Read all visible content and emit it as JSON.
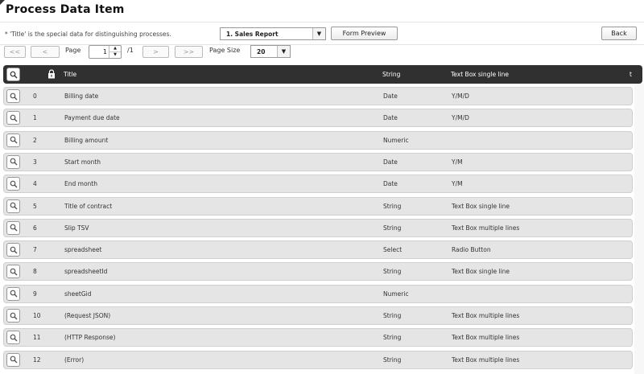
{
  "page": {
    "title": "Process Data Item"
  },
  "toolbar": {
    "note": "* 'Title' is the special data for distinguishing processes.",
    "process_select": {
      "value": "1. Sales Report"
    },
    "form_preview_label": "Form Preview",
    "back_label": "Back"
  },
  "pager": {
    "first": "<<",
    "prev": "<",
    "page_label": "Page",
    "page_value": "1",
    "page_total": "/1",
    "next": ">",
    "last": ">>",
    "page_size_label": "Page Size",
    "page_size_value": "20"
  },
  "table": {
    "headers": {
      "title": "Title",
      "type": "String",
      "display": "Text Box single line",
      "more": "t"
    },
    "rows": [
      {
        "id": "0",
        "title": "Billing date",
        "type": "Date",
        "display": "Y/M/D"
      },
      {
        "id": "1",
        "title": "Payment due date",
        "type": "Date",
        "display": "Y/M/D"
      },
      {
        "id": "2",
        "title": "Billing amount",
        "type": "Numeric",
        "display": ""
      },
      {
        "id": "3",
        "title": "Start month",
        "type": "Date",
        "display": "Y/M"
      },
      {
        "id": "4",
        "title": "End month",
        "type": "Date",
        "display": "Y/M"
      },
      {
        "id": "5",
        "title": "Title of contract",
        "type": "String",
        "display": "Text Box single line"
      },
      {
        "id": "6",
        "title": "Slip TSV",
        "type": "String",
        "display": "Text Box multiple lines"
      },
      {
        "id": "7",
        "title": "spreadsheet",
        "type": "Select",
        "display": "Radio Button"
      },
      {
        "id": "8",
        "title": "spreadsheetId",
        "type": "String",
        "display": "Text Box single line"
      },
      {
        "id": "9",
        "title": "sheetGid",
        "type": "Numeric",
        "display": ""
      },
      {
        "id": "10",
        "title": "(Request JSON)",
        "type": "String",
        "display": "Text Box multiple lines"
      },
      {
        "id": "11",
        "title": "(HTTP Response)",
        "type": "String",
        "display": "Text Box multiple lines"
      },
      {
        "id": "12",
        "title": "(Error)",
        "type": "String",
        "display": "Text Box multiple lines"
      }
    ]
  },
  "icons": {
    "search": "magnifier-icon",
    "lock": "lock-icon",
    "dropdown": "triangle-down-icon"
  }
}
